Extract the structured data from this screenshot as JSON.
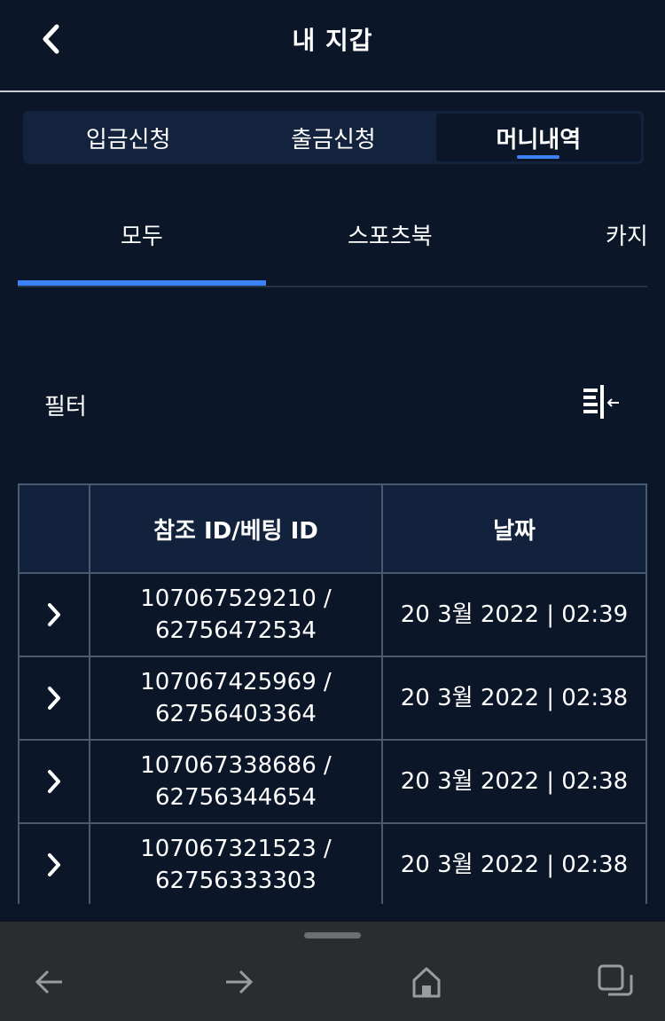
{
  "header": {
    "title": "내 지갑",
    "back_icon": "chevron-left-icon"
  },
  "segment_tabs": [
    {
      "label": "입금신청",
      "active": false
    },
    {
      "label": "출금신청",
      "active": false
    },
    {
      "label": "머니내역",
      "active": true
    }
  ],
  "sub_tabs": [
    {
      "label": "모두",
      "active": true
    },
    {
      "label": "스포츠북",
      "active": false
    },
    {
      "label": "카지",
      "active": false
    }
  ],
  "filter": {
    "label": "필터",
    "icon": "filter-collapse-icon"
  },
  "table": {
    "headers": [
      "",
      "참조 ID/베팅 ID",
      "날짜"
    ],
    "rows": [
      {
        "ref_id": "107067529210 /",
        "bet_id": "62756472534",
        "date": "20 3월 2022 | 02:39"
      },
      {
        "ref_id": "107067425969 /",
        "bet_id": "62756403364",
        "date": "20 3월 2022 | 02:38"
      },
      {
        "ref_id": "107067338686 /",
        "bet_id": "62756344654",
        "date": "20 3월 2022 | 02:38"
      },
      {
        "ref_id": "107067321523 /",
        "bet_id": "62756333303",
        "date": "20 3월 2022 | 02:38"
      }
    ]
  },
  "browser_nav": {
    "icons": [
      "back-arrow-icon",
      "forward-arrow-icon",
      "home-icon",
      "tabs-icon"
    ]
  },
  "colors": {
    "background": "#0b1628",
    "accent": "#3b82f6",
    "header_row": "#12223c",
    "bottom_bar": "#2b2c30"
  }
}
